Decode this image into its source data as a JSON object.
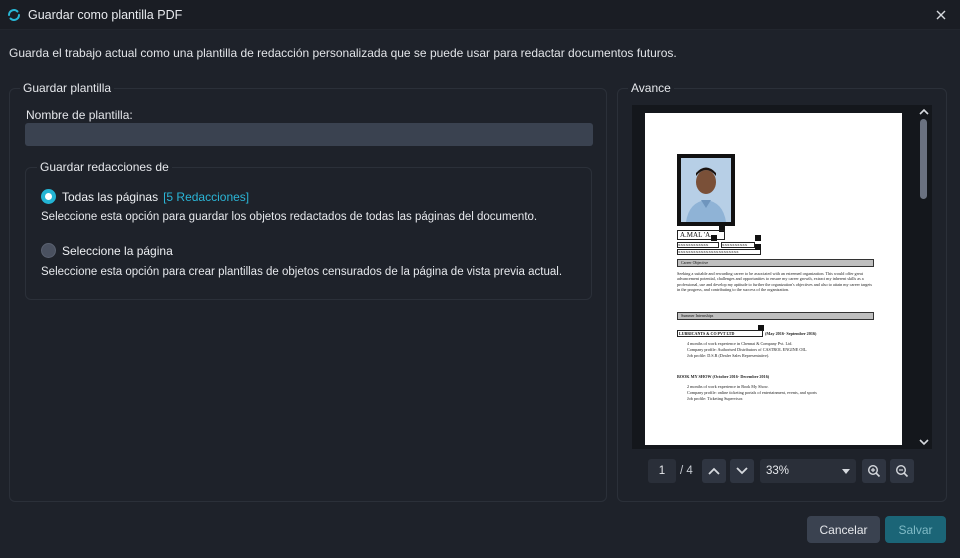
{
  "window": {
    "title": "Guardar como plantilla PDF"
  },
  "description": "Guarda el trabajo actual como una plantilla de redacción personalizada que se puede usar para redactar documentos futuros.",
  "save_template": {
    "legend": "Guardar plantilla",
    "name_label": "Nombre de plantilla:",
    "name_value": "",
    "redactions_group": {
      "legend": "Guardar redacciones de",
      "options": [
        {
          "label": "Todas las páginas",
          "count": "[5 Redacciones]",
          "selected": true,
          "description": "Seleccione esta opción para guardar los objetos redactados de todas las páginas del documento."
        },
        {
          "label": "Seleccione la página",
          "count": "",
          "selected": false,
          "description": "Seleccione esta opción para crear plantillas de objetos censurados de la página de vista previa actual."
        }
      ]
    }
  },
  "preview": {
    "legend": "Avance",
    "current_page": "1",
    "total_pages": "/ 4",
    "zoom": "33%",
    "document": {
      "name": "A.MAL 'A.",
      "contact_1": "XXXXXXXXXXXX",
      "contact_2": "XXXXXXXXXX",
      "contact_3": "XXXXXXXXXXXXXXXXXXXXXXXX",
      "heading_objective": "Career Objective",
      "objective_text": "Seeking a suitable and rewarding career to be associated with an esteemed organization. This would offer great advancement potential, challenges and opportunities to ensure my career growth, extract my inherent skills as a professional, use and develop my aptitude to further the organization's objectives and also to attain my career targets in the progress, and contributing to the success of the organization.",
      "heading_internships": "Summer Internships",
      "internship_1_title": "LUBRICANTS & CO PVT LTD",
      "internship_1_period": "(May 2016- September 2016)",
      "internship_1_bullets": [
        "4 months of work experience in Chennai & Company Pvt. Ltd.",
        "Company profile: Authorised Distributors of CASTROL ENGINE OIL.",
        "Job profile: D.S.R (Dealer Sales Representative)."
      ],
      "internship_2_title": "BOOK MY SHOW (October 2016- December 2016)",
      "internship_2_bullets": [
        "2 months of work experience in Book My Show.",
        "Company profile: online ticketing portals of entertainment, events, and sports",
        "Job profile: Ticketing Supervisor."
      ]
    }
  },
  "buttons": {
    "cancel": "Cancelar",
    "save": "Salvar"
  },
  "colors": {
    "accent": "#23b4d4",
    "background": "#1e222a",
    "save_button": "#1b6577"
  },
  "icons": [
    "app-logo-icon",
    "close-icon",
    "chevron-up-icon",
    "chevron-down-icon",
    "zoom-in-icon",
    "zoom-out-icon",
    "dropdown-caret-icon"
  ]
}
